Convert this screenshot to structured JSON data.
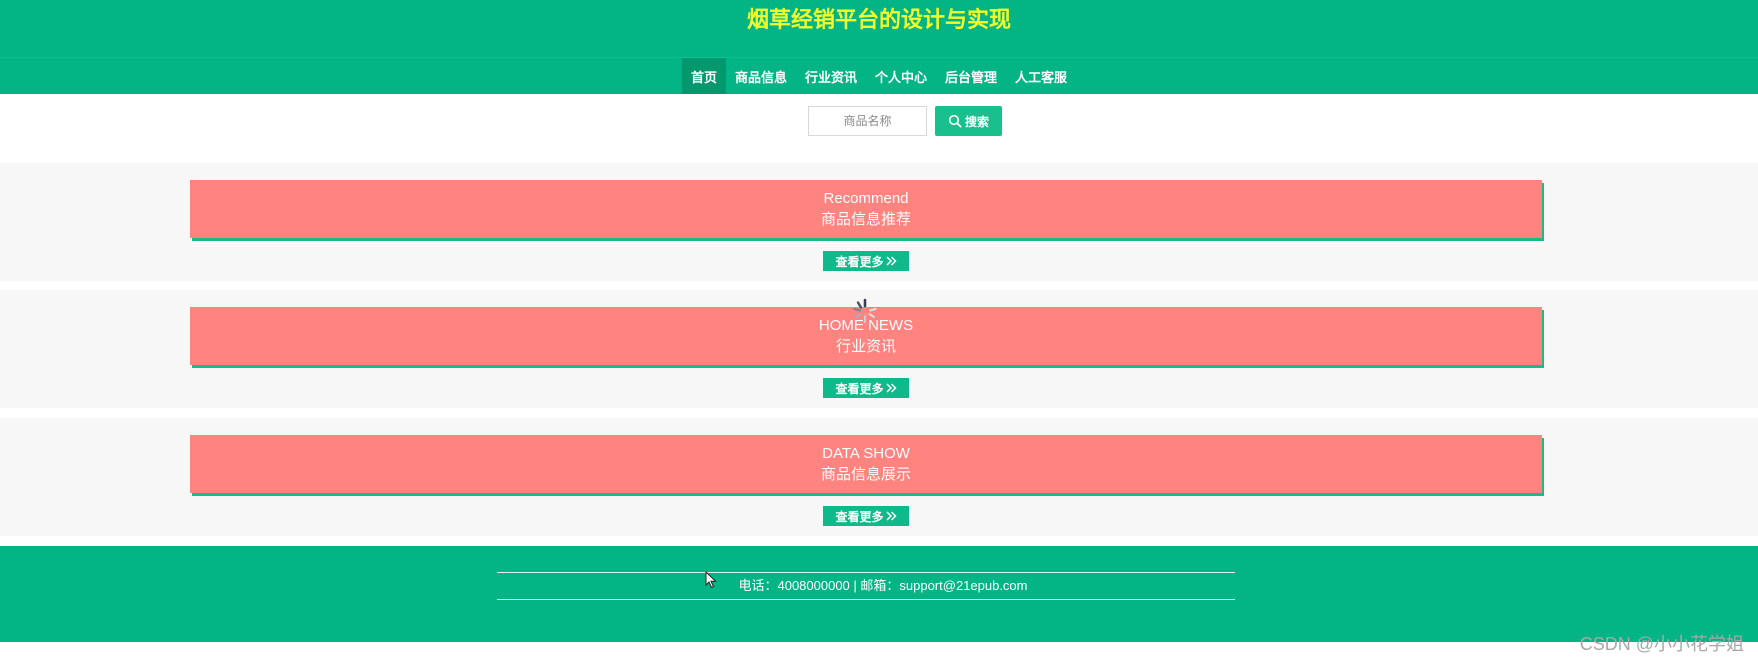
{
  "header": {
    "title": "烟草经销平台的设计与实现"
  },
  "nav": {
    "items": [
      {
        "label": "首页",
        "active": true
      },
      {
        "label": "商品信息",
        "active": false
      },
      {
        "label": "行业资讯",
        "active": false
      },
      {
        "label": "个人中心",
        "active": false
      },
      {
        "label": "后台管理",
        "active": false
      },
      {
        "label": "人工客服",
        "active": false
      }
    ]
  },
  "search": {
    "placeholder": "商品名称",
    "button_label": "搜索"
  },
  "sections": [
    {
      "en": "Recommend",
      "cn": "商品信息推荐",
      "more": "查看更多"
    },
    {
      "en": "HOME NEWS",
      "cn": "行业资讯",
      "more": "查看更多"
    },
    {
      "en": "DATA SHOW",
      "cn": "商品信息展示",
      "more": "查看更多"
    }
  ],
  "footer": {
    "contact": "电话：4008000000 | 邮箱：support@21epub.com"
  },
  "watermark": "CSDN @小小花学姐",
  "colors": {
    "primary": "#03b585",
    "title": "#f3ff2b",
    "banner": "#ff837f",
    "nav_active": "#04986f"
  }
}
